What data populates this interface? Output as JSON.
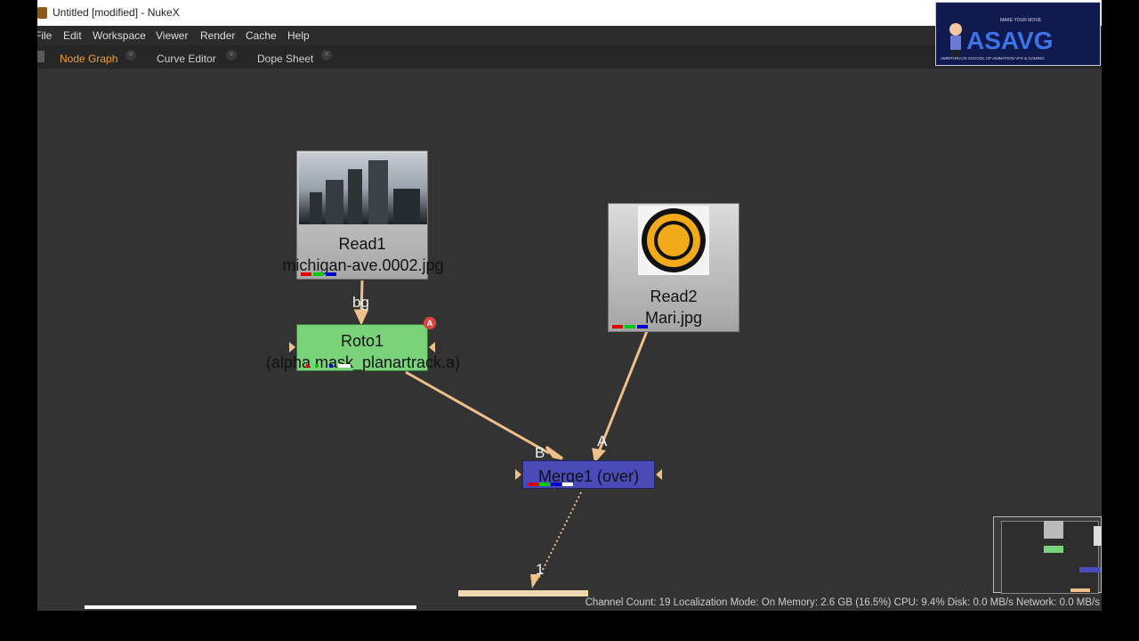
{
  "window": {
    "title": "Untitled [modified] - NukeX"
  },
  "menu": [
    "File",
    "Edit",
    "Workspace",
    "Viewer",
    "Render",
    "Cache",
    "Help"
  ],
  "tabs": [
    {
      "label": "Node Graph",
      "close": "×",
      "active": true
    },
    {
      "label": "Curve Editor",
      "close": "×",
      "active": false
    },
    {
      "label": "Dope Sheet",
      "close": "×",
      "active": false
    }
  ],
  "nodes": {
    "read1": {
      "name": "Read1",
      "file": "michigan-ave.0002.jpg"
    },
    "read2": {
      "name": "Read2",
      "file": "Mari.jpg"
    },
    "roto1": {
      "name": "Roto1",
      "sub": "(alpha mask_planartrack.a)",
      "badge": "A"
    },
    "merge1": {
      "name": "Merge1 (over)"
    }
  },
  "edge_labels": {
    "bg": "bg",
    "b": "B",
    "a": "A",
    "one": "1"
  },
  "status_bar": "Channel Count: 19  Localization Mode: On  Memory: 2.6 GB (16.5%)  CPU: 9.4%  Disk: 0.0 MB/s  Network: 0.0 MB/s",
  "watermark": {
    "tagline": "MAKE YOUR MOVE",
    "brand": "ASAVG",
    "subline": "AMRITHRAJ'S SCHOOL OF ANIMATION VFX & GAMING"
  },
  "colors": {
    "accent_tab": "#f0a030",
    "edge": "#f0c08a",
    "roto": "#7ad27a",
    "merge": "#4a4ab8",
    "node_gray": "#b8b8b8"
  }
}
